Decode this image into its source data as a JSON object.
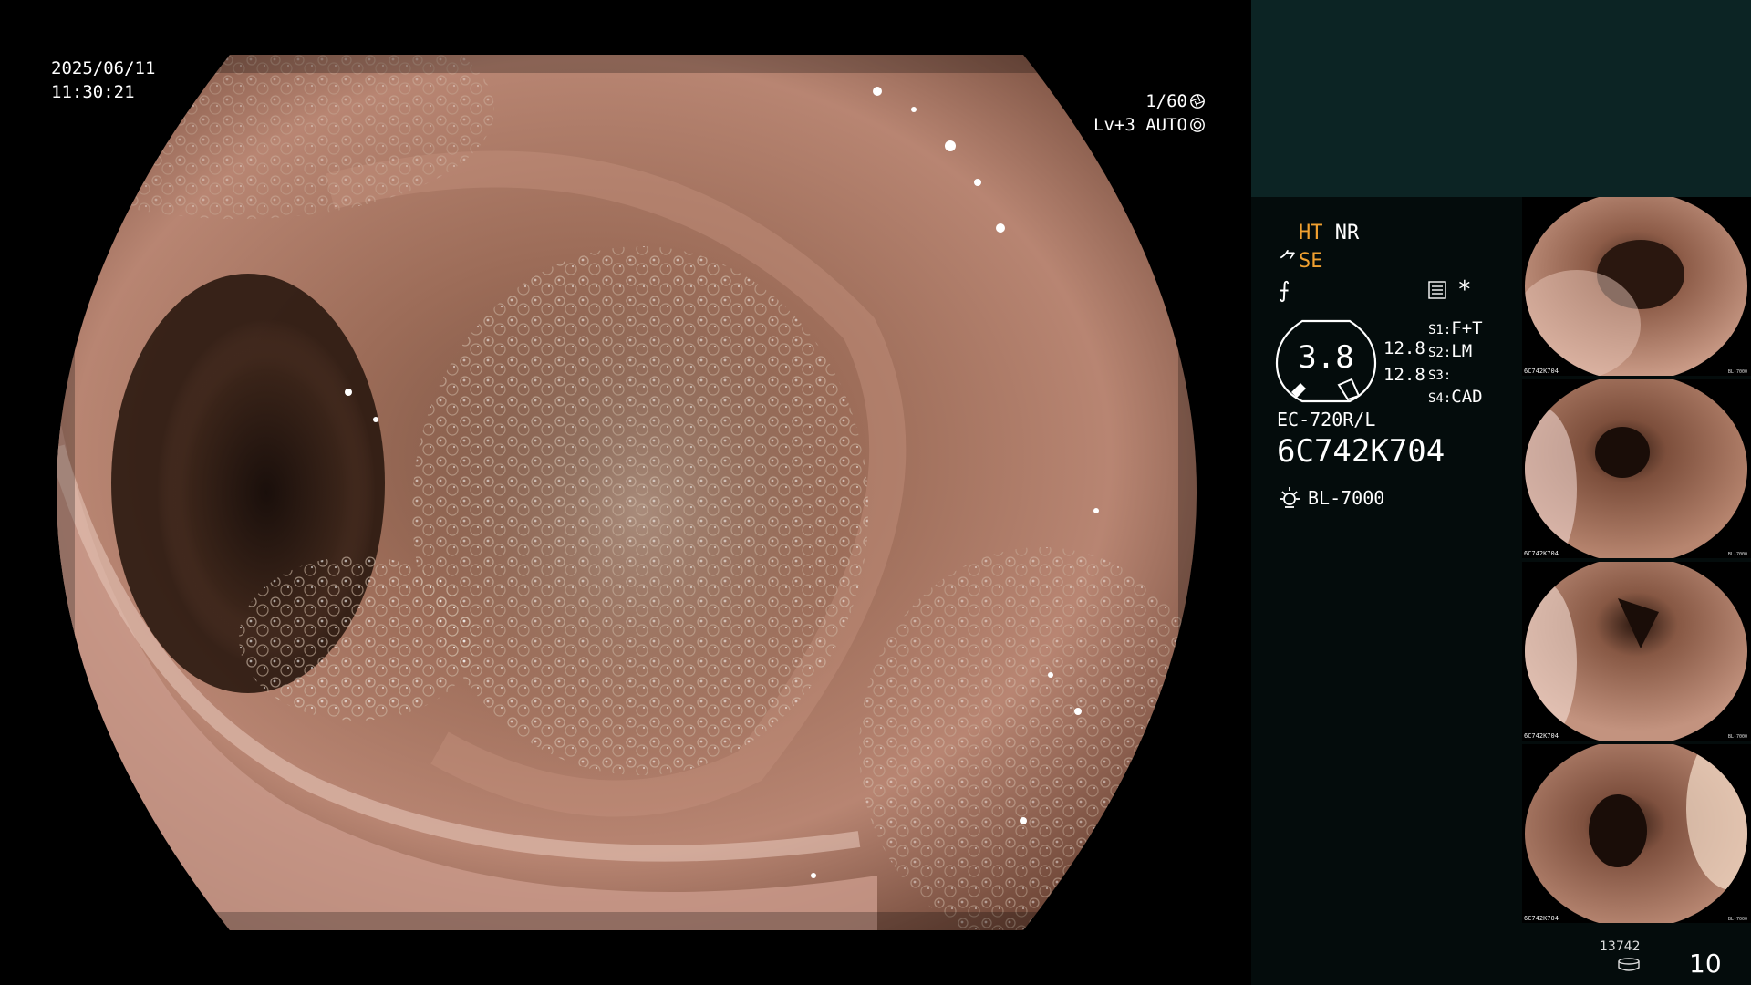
{
  "overlay": {
    "date": "2025/06/11",
    "time": "11:30:21",
    "shutter": "1/60",
    "level": "Lv+3 AUTO",
    "shutter_icon": "aperture-icon",
    "auto_icon": "iris-icon"
  },
  "panel": {
    "ht": "HT",
    "nr": "NR",
    "se": "SE",
    "f_symbol": "⨍",
    "star": "*",
    "zoom": "3.8",
    "zoom_a": "12.8",
    "zoom_b": "12.8",
    "switches": [
      {
        "label": "S1:",
        "value": "F+T"
      },
      {
        "label": "S2:",
        "value": "LM"
      },
      {
        "label": "S3:",
        "value": ""
      },
      {
        "label": "S4:",
        "value": "CAD"
      }
    ],
    "scope_model": "EC-720R/L",
    "scope_serial": "6C742K704",
    "light_source": "BL-7000",
    "highlight_color": "#f0a030"
  },
  "thumbnails": [
    {
      "serial": "6C742K704",
      "light": "BL-7000"
    },
    {
      "serial": "6C742K704",
      "light": "BL-7000"
    },
    {
      "serial": "6C742K704",
      "light": "BL-7000"
    },
    {
      "serial": "6C742K704",
      "light": "BL-7000"
    }
  ],
  "footer": {
    "counter_small": "13742",
    "counter_big": "10"
  }
}
